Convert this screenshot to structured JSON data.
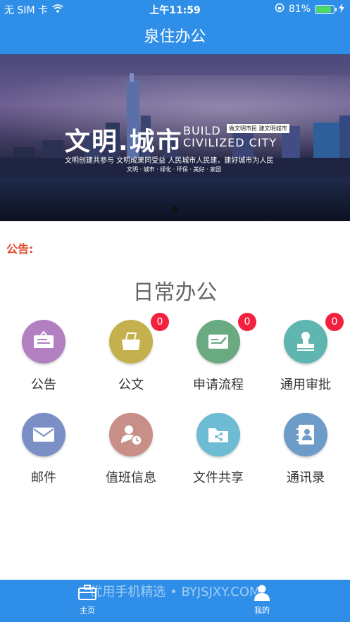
{
  "status_bar": {
    "carrier": "无 SIM 卡",
    "time": "上午11:59",
    "battery": "81%",
    "battery_level": 0.81
  },
  "header": {
    "title": "泉住办公"
  },
  "banner": {
    "headline_cn": "文明.城市",
    "headline_en_line1": "BUILD",
    "headline_en_line2": "CIVILIZED CITY",
    "tag": "做文明市民 建文明城市",
    "subtitle": "文明创建共参与 文明成果同受益 人民城市人民建，建好城市为人民",
    "subtitle2": "文明 · 城市 · 绿化 · 环保 · 美好 · 家园"
  },
  "notice": {
    "label": "公告:"
  },
  "section": {
    "title": "日常办公"
  },
  "grid": [
    {
      "label": "公告",
      "icon": "notice-board-icon",
      "color": "#b27fc1",
      "badge": ""
    },
    {
      "label": "公文",
      "icon": "document-tray-icon",
      "color": "#c4b04d",
      "badge": "0"
    },
    {
      "label": "申请流程",
      "icon": "edit-form-icon",
      "color": "#6aaa82",
      "badge": "0"
    },
    {
      "label": "通用审批",
      "icon": "stamp-icon",
      "color": "#5fb5b0",
      "badge": "0"
    },
    {
      "label": "邮件",
      "icon": "mail-icon",
      "color": "#7b8fc7",
      "badge": ""
    },
    {
      "label": "值班信息",
      "icon": "person-clock-icon",
      "color": "#c78f87",
      "badge": ""
    },
    {
      "label": "文件共享",
      "icon": "shared-folder-icon",
      "color": "#6ebcd4",
      "badge": ""
    },
    {
      "label": "通讯录",
      "icon": "address-book-icon",
      "color": "#6e9cc9",
      "badge": ""
    }
  ],
  "tabbar": {
    "home_label": "主页",
    "me_label": "我的",
    "watermark": "优用手机精选 • BYJSJXY.COM"
  },
  "colors": {
    "primary": "#2f8fe8",
    "notice": "#e64a2e",
    "badge": "#f2213f"
  }
}
